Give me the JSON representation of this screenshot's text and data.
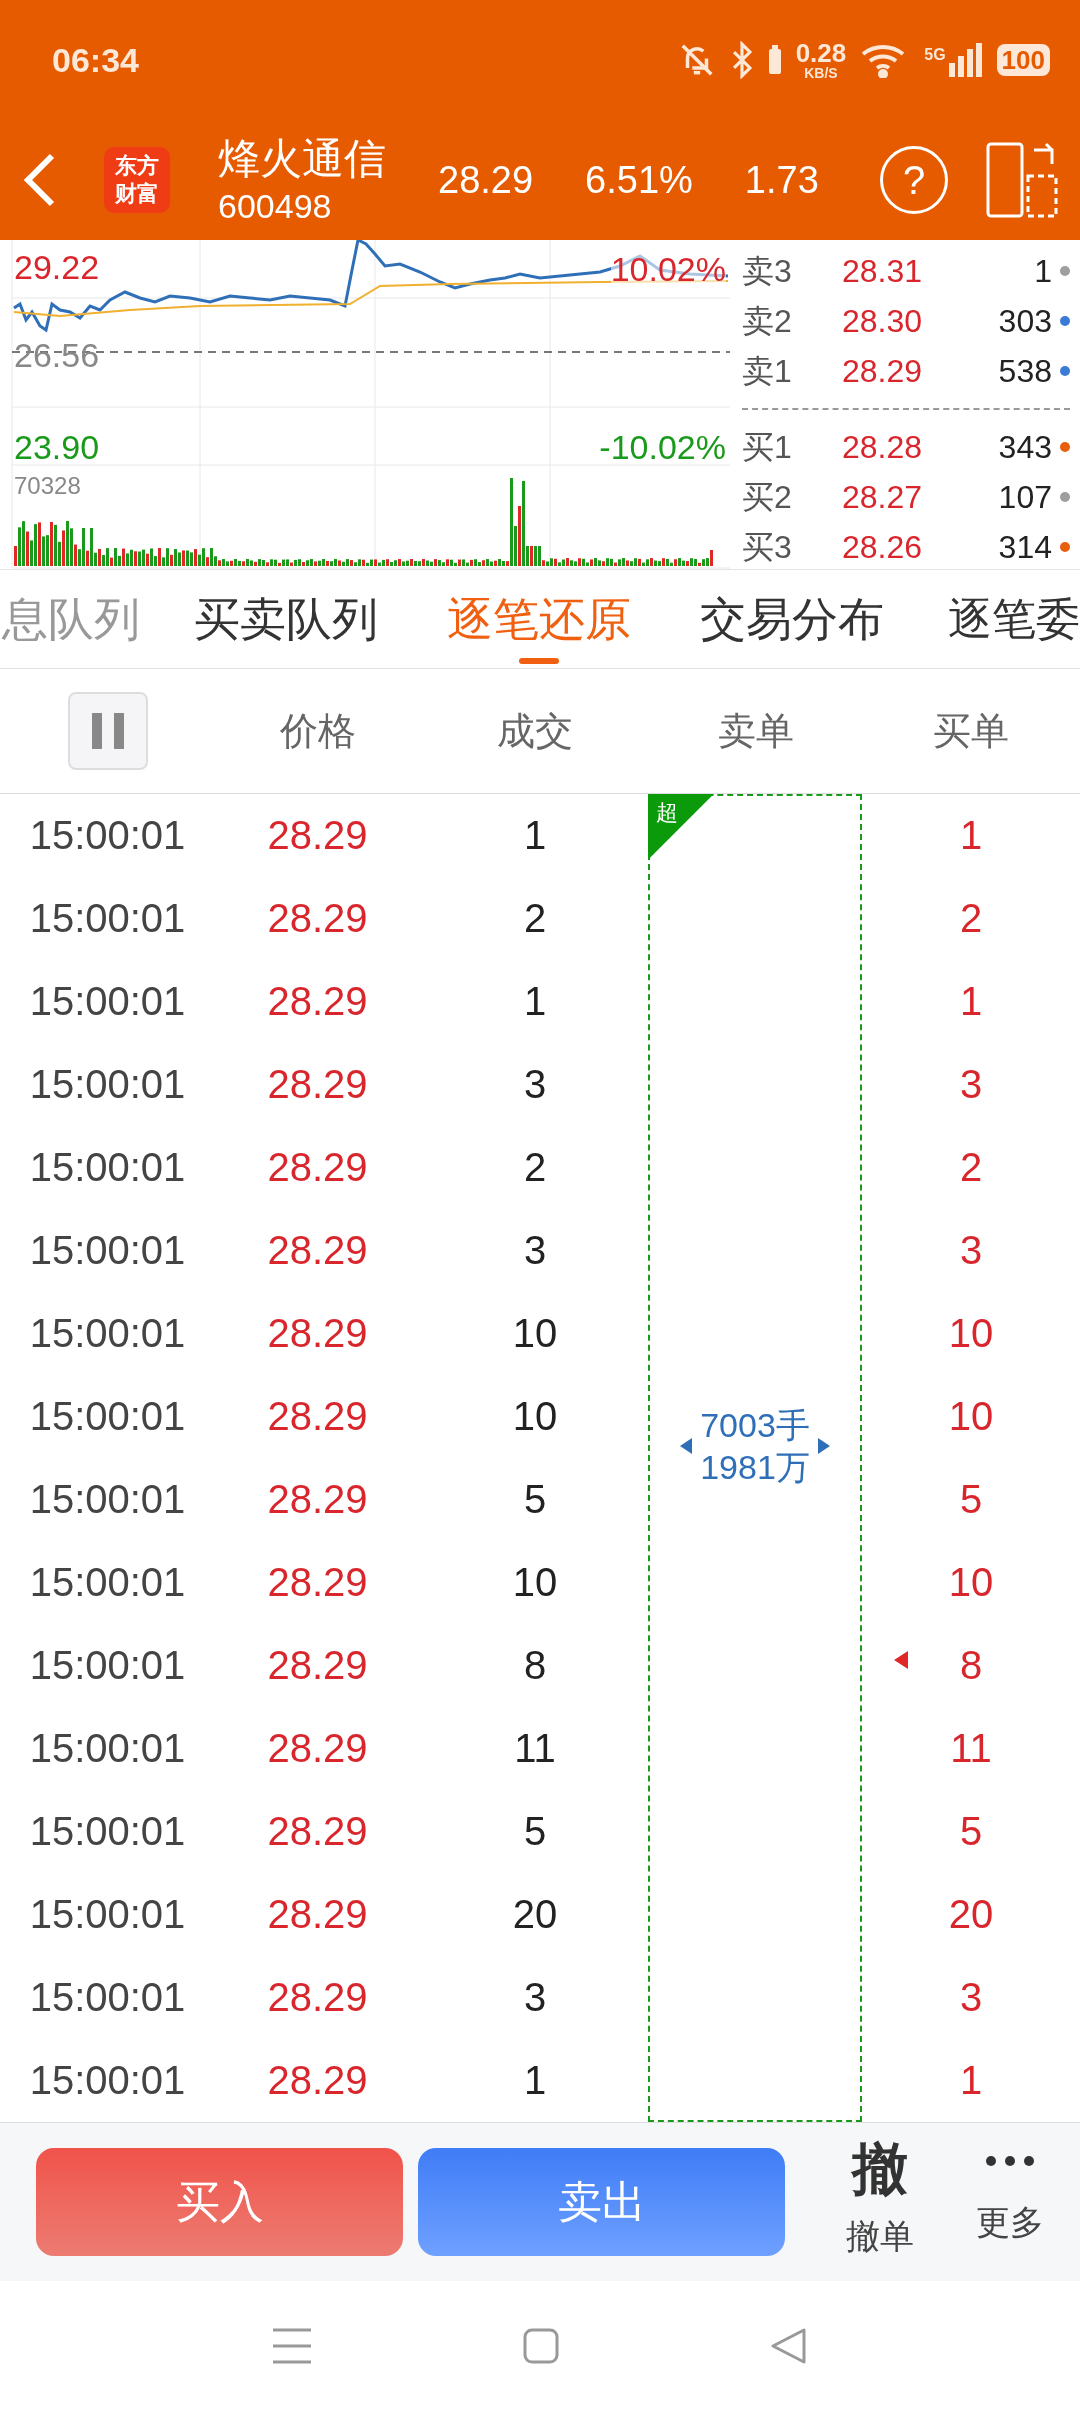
{
  "status_bar": {
    "time": "06:34",
    "speed": "0.28",
    "speed_unit": "KB/S",
    "network": "5G",
    "battery": "100"
  },
  "header": {
    "logo": "东方财富",
    "name": "烽火通信",
    "code": "600498",
    "price": "28.29",
    "change_pct": "6.51%",
    "change": "1.73",
    "help": "?"
  },
  "chart": {
    "high": "29.22",
    "high_pct": "10.02%",
    "prev_close": "26.56",
    "low": "23.90",
    "low_pct": "-10.02%",
    "volume_max": "70328"
  },
  "order_book": {
    "asks": [
      {
        "label": "卖3",
        "price": "28.31",
        "volume": "1",
        "color": "#9e9e9e"
      },
      {
        "label": "卖2",
        "price": "28.30",
        "volume": "303",
        "color": "#3a7bd5"
      },
      {
        "label": "卖1",
        "price": "28.29",
        "volume": "538",
        "color": "#3a7bd5"
      }
    ],
    "bids": [
      {
        "label": "买1",
        "price": "28.28",
        "volume": "343",
        "color": "#e8600c"
      },
      {
        "label": "买2",
        "price": "28.27",
        "volume": "107",
        "color": "#9e9e9e"
      },
      {
        "label": "买3",
        "price": "28.26",
        "volume": "314",
        "color": "#e8600c"
      }
    ]
  },
  "tabs": [
    {
      "label": "息队列",
      "selected": false
    },
    {
      "label": "买卖队列",
      "selected": false
    },
    {
      "label": "逐笔还原",
      "selected": true
    },
    {
      "label": "交易分布",
      "selected": false
    },
    {
      "label": "逐笔委",
      "selected": false
    }
  ],
  "table": {
    "columns": [
      "价格",
      "成交",
      "卖单",
      "买单"
    ],
    "big_order": {
      "badge": "超",
      "lots": "7003手",
      "amount": "1981万"
    },
    "rows": [
      {
        "time": "15:00:01",
        "price": "28.29",
        "volume": "1",
        "buy": "1",
        "marker": false
      },
      {
        "time": "15:00:01",
        "price": "28.29",
        "volume": "2",
        "buy": "2",
        "marker": false
      },
      {
        "time": "15:00:01",
        "price": "28.29",
        "volume": "1",
        "buy": "1",
        "marker": false
      },
      {
        "time": "15:00:01",
        "price": "28.29",
        "volume": "3",
        "buy": "3",
        "marker": false
      },
      {
        "time": "15:00:01",
        "price": "28.29",
        "volume": "2",
        "buy": "2",
        "marker": false
      },
      {
        "time": "15:00:01",
        "price": "28.29",
        "volume": "3",
        "buy": "3",
        "marker": false
      },
      {
        "time": "15:00:01",
        "price": "28.29",
        "volume": "10",
        "buy": "10",
        "marker": false
      },
      {
        "time": "15:00:01",
        "price": "28.29",
        "volume": "10",
        "buy": "10",
        "marker": false
      },
      {
        "time": "15:00:01",
        "price": "28.29",
        "volume": "5",
        "buy": "5",
        "marker": false
      },
      {
        "time": "15:00:01",
        "price": "28.29",
        "volume": "10",
        "buy": "10",
        "marker": false
      },
      {
        "time": "15:00:01",
        "price": "28.29",
        "volume": "8",
        "buy": "8",
        "marker": true
      },
      {
        "time": "15:00:01",
        "price": "28.29",
        "volume": "11",
        "buy": "11",
        "marker": false
      },
      {
        "time": "15:00:01",
        "price": "28.29",
        "volume": "5",
        "buy": "5",
        "marker": false
      },
      {
        "time": "15:00:01",
        "price": "28.29",
        "volume": "20",
        "buy": "20",
        "marker": false
      },
      {
        "time": "15:00:01",
        "price": "28.29",
        "volume": "3",
        "buy": "3",
        "marker": false
      },
      {
        "time": "15:00:01",
        "price": "28.29",
        "volume": "1",
        "buy": "1",
        "marker": false
      }
    ]
  },
  "actions": {
    "buy": "买入",
    "sell": "卖出",
    "cancel_glyph": "撤",
    "cancel": "撤单",
    "more": "更多"
  }
}
